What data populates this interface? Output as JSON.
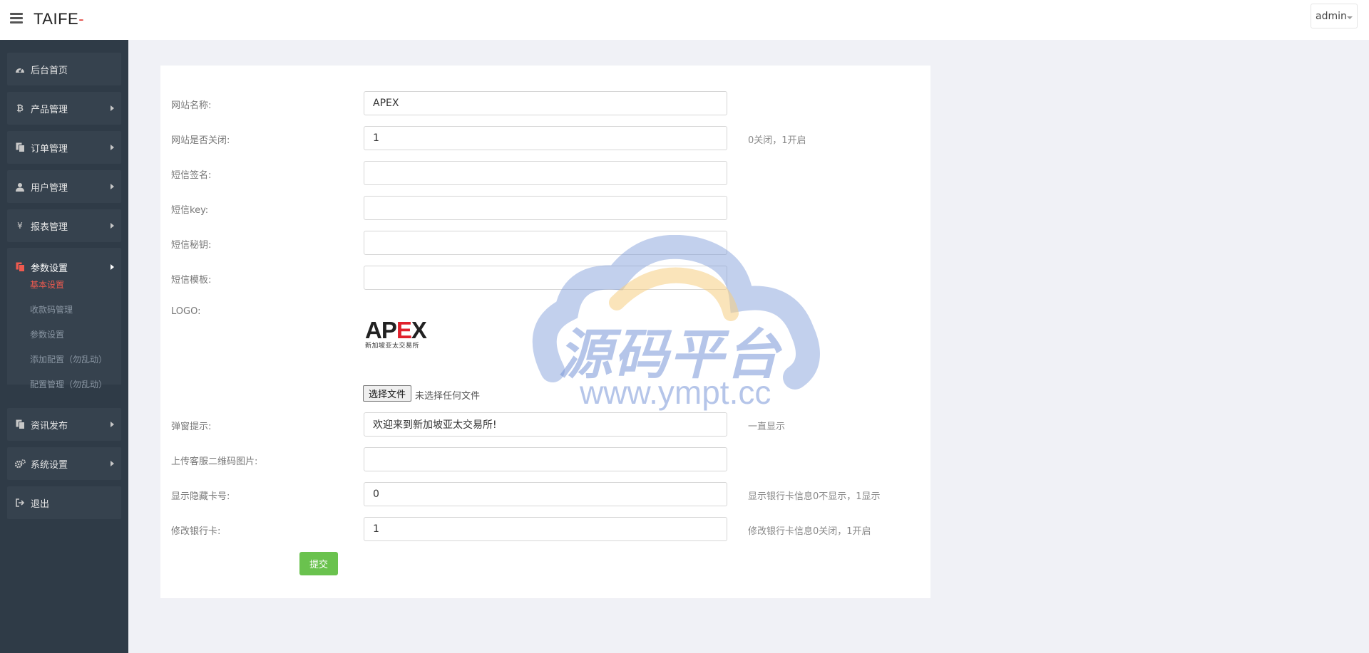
{
  "header": {
    "brand_text": "TAIFE",
    "brand_suffix": "-",
    "user_label": "admin"
  },
  "sidebar": {
    "items": [
      {
        "label": "后台首页",
        "icon": "dashboard-icon"
      },
      {
        "label": "产品管理",
        "icon": "bitcoin-icon"
      },
      {
        "label": "订单管理",
        "icon": "copy-icon"
      },
      {
        "label": "用户管理",
        "icon": "user-icon"
      },
      {
        "label": "报表管理",
        "icon": "yen-icon"
      },
      {
        "label": "参数设置",
        "icon": "copy-icon"
      },
      {
        "label": "资讯发布",
        "icon": "copy-icon"
      },
      {
        "label": "系统设置",
        "icon": "gears-icon"
      },
      {
        "label": "退出",
        "icon": "sign-out-icon"
      }
    ],
    "sub_items": [
      "基本设置",
      "收款码管理",
      "参数设置",
      "添加配置（勿乱动）",
      "配置管理（勿乱动）"
    ],
    "active_sub_color": "#ef5a4f"
  },
  "form": {
    "site_name": {
      "label": "网站名称:",
      "value": "APEX"
    },
    "site_closed": {
      "label": "网站是否关闭:",
      "value": "1",
      "hint": "0关闭，1开启"
    },
    "sms_sign": {
      "label": "短信签名:",
      "value": ""
    },
    "sms_key": {
      "label": "短信key:",
      "value": ""
    },
    "sms_secret": {
      "label": "短信秘钥:",
      "value": ""
    },
    "sms_template": {
      "label": "短信模板:",
      "value": ""
    },
    "logo": {
      "label": "LOGO:",
      "logo_word_a": "AP",
      "logo_word_e": "E",
      "logo_word_x": "X",
      "logo_sub": "新加坡亚太交易所",
      "file_button": "选择文件",
      "file_status": "未选择任何文件"
    },
    "popup_tip": {
      "label": "弹窗提示:",
      "value": "欢迎来到新加坡亚太交易所!",
      "hint": "一直显示"
    },
    "qr_upload": {
      "label": "上传客服二维码图片:",
      "value": ""
    },
    "hide_card": {
      "label": "显示隐藏卡号:",
      "value": "0",
      "hint": "显示银行卡信息0不显示，1显示"
    },
    "edit_card": {
      "label": "修改银行卡:",
      "value": "1",
      "hint": "修改银行卡信息0关闭，1开启"
    },
    "submit_label": "提交"
  },
  "watermark": {
    "text": "源码平台",
    "url": "www.ympt.cc"
  },
  "colors": {
    "sidebar_bg": "#2f3b47",
    "submit_green": "#6ac24e",
    "accent_red": "#e0403a"
  }
}
